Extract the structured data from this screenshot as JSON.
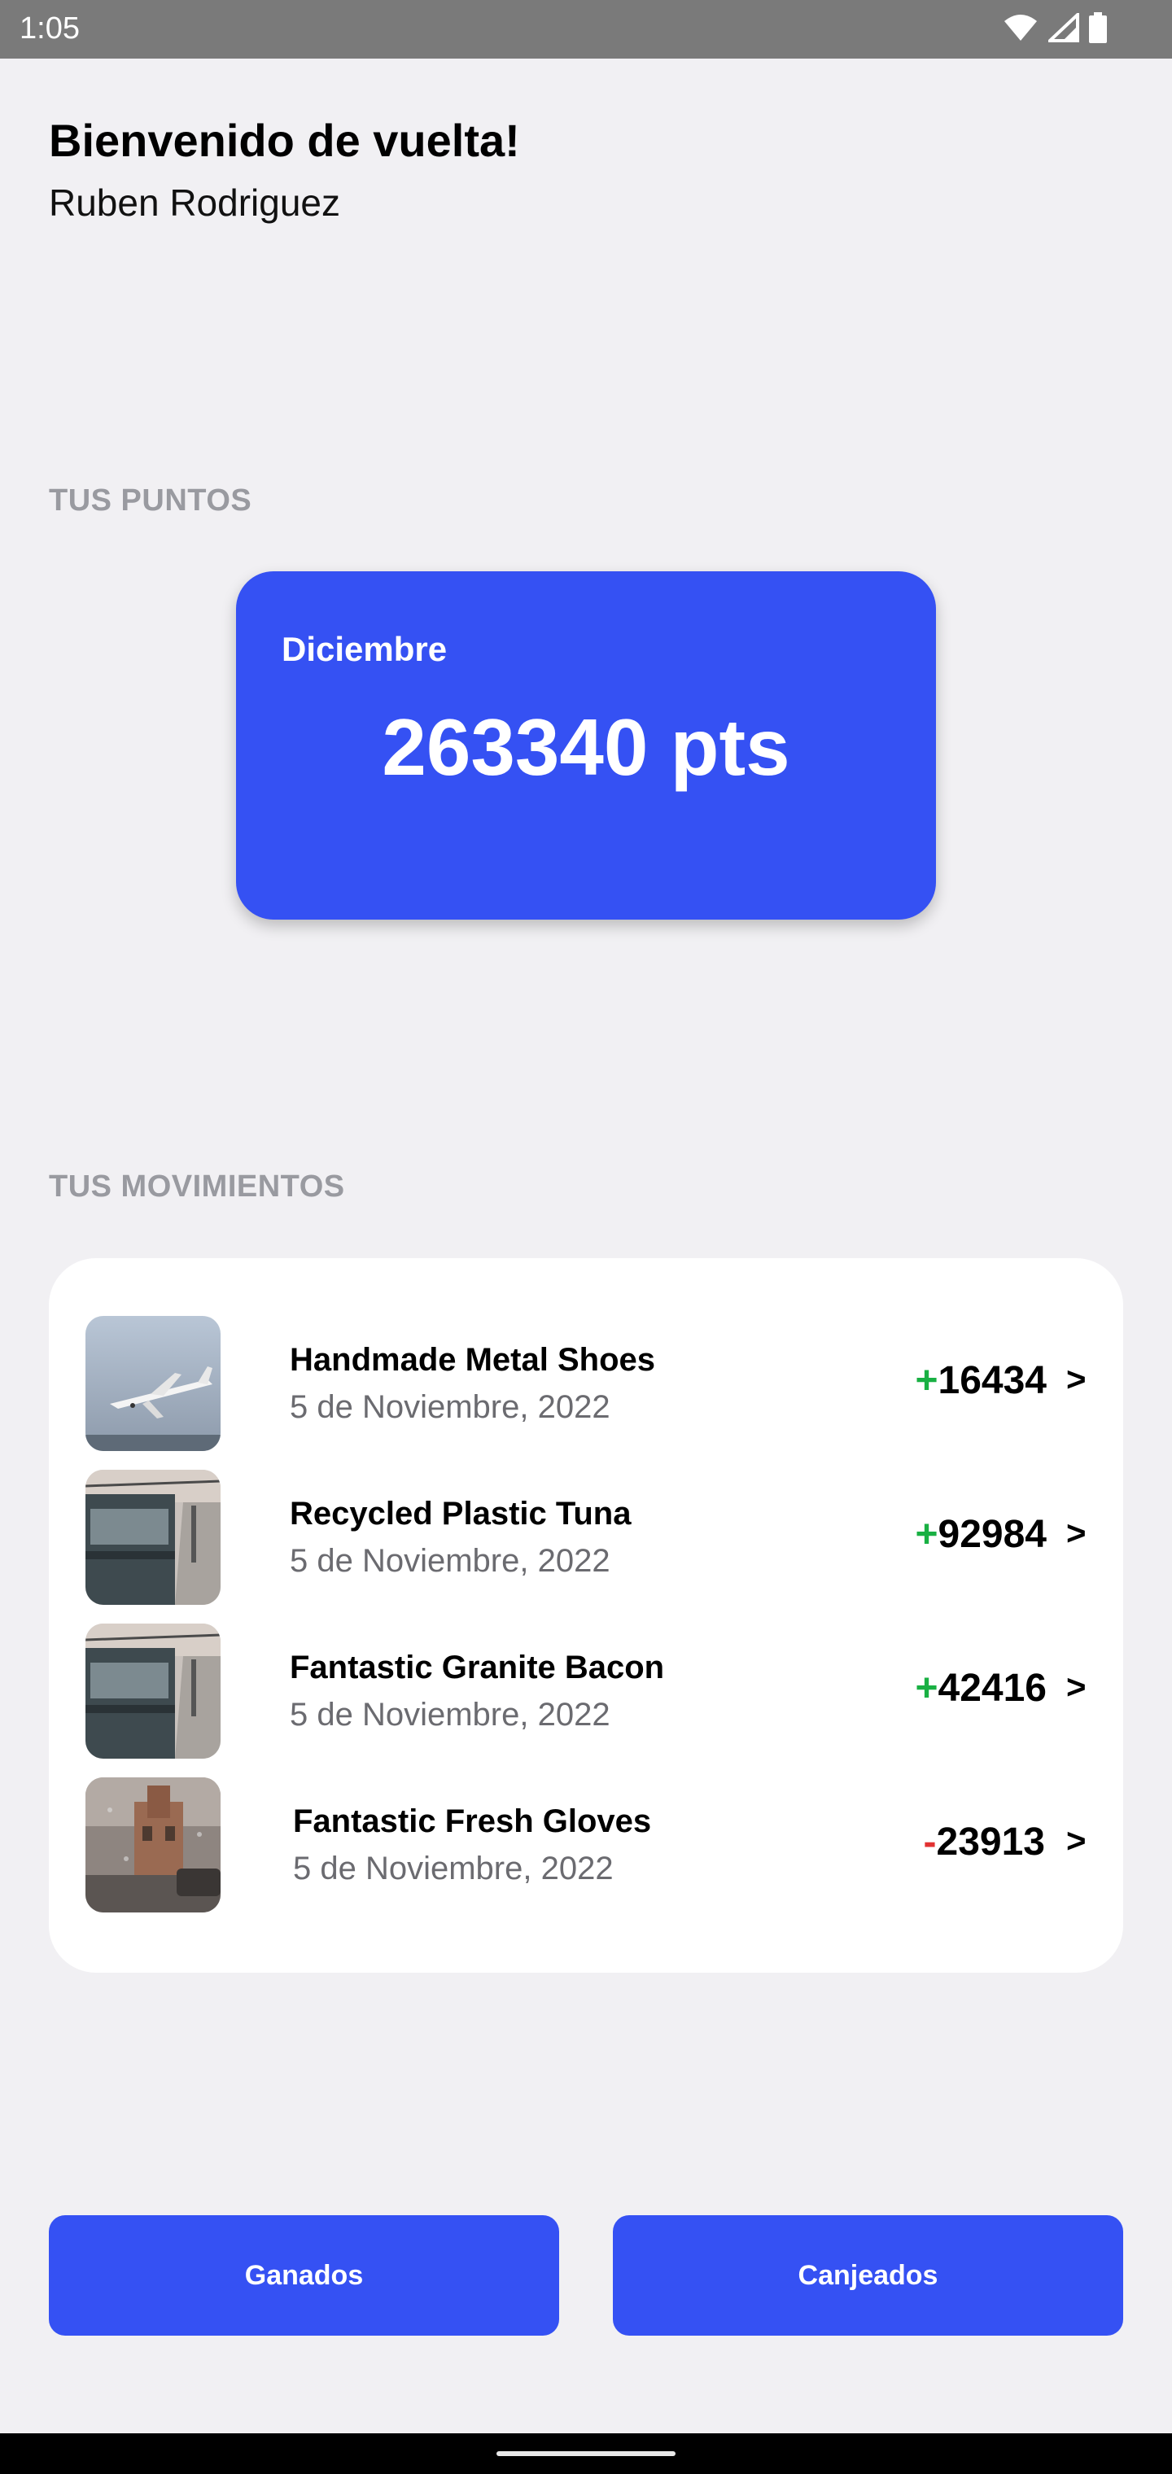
{
  "status_bar": {
    "time": "1:05",
    "icons": [
      "wifi-icon",
      "signal-icon",
      "battery-icon"
    ]
  },
  "header": {
    "greeting": "Bienvenido de vuelta!",
    "user_name": "Ruben Rodriguez"
  },
  "points_section": {
    "label": "TUS PUNTOS",
    "card": {
      "month": "Diciembre",
      "points": "263340 pts"
    }
  },
  "movements_section": {
    "label": "TUS MOVIMIENTOS",
    "items": [
      {
        "title": "Handmade Metal Shoes",
        "date": "5 de Noviembre, 2022",
        "sign": "+",
        "amount": "16434",
        "chevron": ">",
        "image": "airplane-photo"
      },
      {
        "title": "Recycled Plastic Tuna",
        "date": "5 de Noviembre, 2022",
        "sign": "+",
        "amount": "92984",
        "chevron": ">",
        "image": "train-photo"
      },
      {
        "title": "Fantastic Granite Bacon",
        "date": "5 de Noviembre, 2022",
        "sign": "+",
        "amount": "42416",
        "chevron": ">",
        "image": "train-photo"
      },
      {
        "title": "Fantastic Fresh Gloves",
        "date": "5 de Noviembre, 2022",
        "sign": "-",
        "amount": "23913",
        "chevron": ">",
        "image": "rainy-street-photo"
      }
    ]
  },
  "actions": {
    "earned_label": "Ganados",
    "redeemed_label": "Canjeados"
  },
  "colors": {
    "accent": "#3551f3",
    "background": "#f1f0f3",
    "positive": "#19b043",
    "negative": "#e23232",
    "section_label": "#999aa0"
  }
}
